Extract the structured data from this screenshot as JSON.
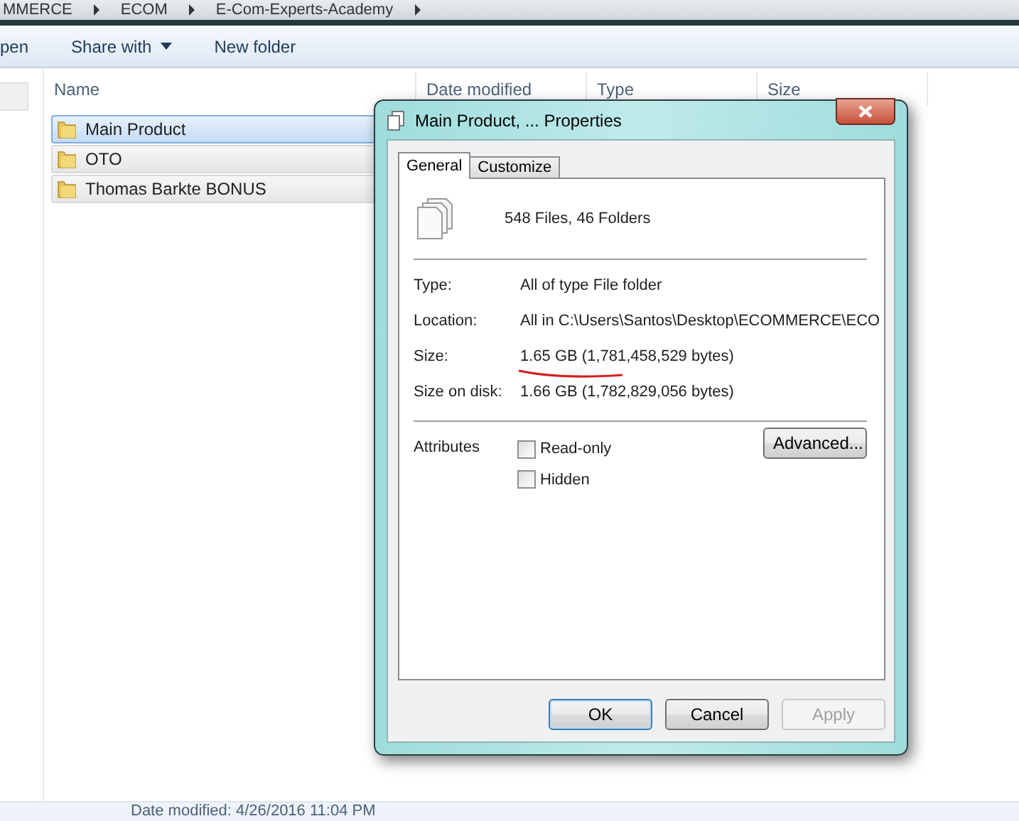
{
  "explorer": {
    "breadcrumb": [
      "MMERCE",
      "ECOM",
      "E-Com-Experts-Academy"
    ],
    "toolbar": [
      {
        "label": "pen",
        "dropdown": false
      },
      {
        "label": "Share with",
        "dropdown": true
      },
      {
        "label": "New folder",
        "dropdown": false
      }
    ],
    "columns": [
      "Name",
      "Date modified",
      "Type",
      "Size"
    ],
    "rows": [
      {
        "name": "Main Product",
        "selected": true,
        "focused": true
      },
      {
        "name": "OTO",
        "selected": true,
        "focused": false
      },
      {
        "name": "Thomas Barkte BONUS",
        "selected": true,
        "focused": false
      }
    ],
    "status": "Date modified: 4/26/2016 11:04 PM"
  },
  "dialog": {
    "title": "Main Product, ... Properties",
    "tabs": [
      {
        "label": "General",
        "selected": true
      },
      {
        "label": "Customize",
        "selected": false
      }
    ],
    "summary": "548 Files, 46 Folders",
    "fields": [
      {
        "label": "Type:",
        "value": "All of type File folder",
        "underlined": false
      },
      {
        "label": "Location:",
        "value": "All in C:\\Users\\Santos\\Desktop\\ECOMMERCE\\ECO",
        "underlined": false
      },
      {
        "label": "Size:",
        "value": "1.65 GB (1,781,458,529 bytes)",
        "underlined": true
      },
      {
        "label": "Size on disk:",
        "value": "1.66 GB (1,782,829,056 bytes)",
        "underlined": false
      }
    ],
    "attributes_label": "Attributes",
    "checkboxes": [
      {
        "label": "Read-only",
        "checked": false
      },
      {
        "label": "Hidden",
        "checked": false
      }
    ],
    "advanced_button": "Advanced...",
    "buttons": [
      {
        "label": "OK",
        "default": true,
        "disabled": false
      },
      {
        "label": "Cancel",
        "default": false,
        "disabled": false
      },
      {
        "label": "Apply",
        "default": false,
        "disabled": true
      }
    ]
  }
}
